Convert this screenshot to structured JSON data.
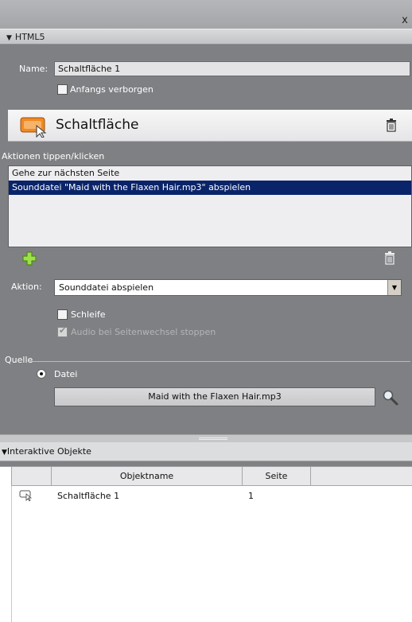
{
  "window": {
    "close_glyph": "x"
  },
  "section": {
    "title": "HTML5"
  },
  "props": {
    "name_label": "Name:",
    "name_value": "Schaltfläche 1",
    "hidden_label": "Anfangs verborgen"
  },
  "object": {
    "title": "Schaltfläche"
  },
  "actions": {
    "header": "Aktionen tippen/klicken",
    "items": [
      {
        "label": "Gehe zur nächsten Seite",
        "selected": false
      },
      {
        "label": "Sounddatei \"Maid with the Flaxen Hair.mp3\" abspielen",
        "selected": true
      }
    ]
  },
  "action_detail": {
    "label": "Aktion:",
    "value": "Sounddatei abspielen",
    "loop_label": "Schleife",
    "stop_audio_label": "Audio bei Seitenwechsel stoppen"
  },
  "source": {
    "label": "Quelle",
    "file_label": "Datei",
    "file_name": "Maid with the Flaxen Hair.mp3"
  },
  "interactive": {
    "title": "Interaktive Objekte",
    "columns": [
      "Objektname",
      "Seite"
    ],
    "rows": [
      {
        "name": "Schaltfläche 1",
        "page": "1"
      }
    ]
  },
  "colors": {
    "selection": "#0a246a",
    "add_icon": "#7ed321"
  }
}
